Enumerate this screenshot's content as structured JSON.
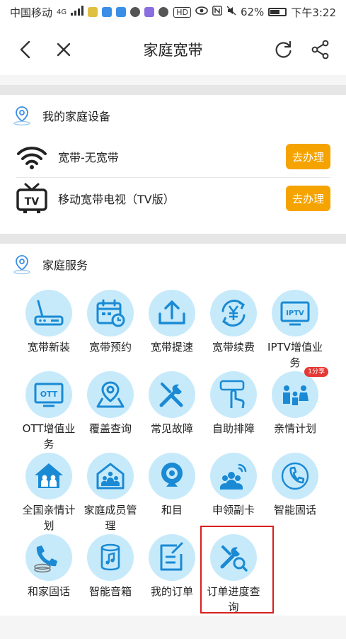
{
  "status_bar": {
    "carrier": "中国移动",
    "network": "4G",
    "battery_percent": "62%",
    "battery_level": 0.62,
    "time": "下午3:22",
    "hd": "HD"
  },
  "nav": {
    "title": "家庭宽带"
  },
  "devices": {
    "title": "我的家庭设备",
    "items": [
      {
        "name": "宽带-无宽带",
        "action": "去办理"
      },
      {
        "name": "移动宽带电视（TV版）",
        "action": "去办理",
        "tv_label": "TV"
      }
    ]
  },
  "services": {
    "title": "家庭服务",
    "items": [
      {
        "label": "宽带新装"
      },
      {
        "label": "宽带预约"
      },
      {
        "label": "宽带提速"
      },
      {
        "label": "宽带续费"
      },
      {
        "label": "IPTV增值业务",
        "icon_text": "IPTV"
      },
      {
        "label": "OTT增值业务",
        "icon_text": "OTT"
      },
      {
        "label": "覆盖查询"
      },
      {
        "label": "常见故障"
      },
      {
        "label": "自助排障"
      },
      {
        "label": "亲情计划",
        "badge": "1分享"
      },
      {
        "label": "全国亲情计划"
      },
      {
        "label": "家庭成员管理"
      },
      {
        "label": "和目"
      },
      {
        "label": "申领副卡"
      },
      {
        "label": "智能固话"
      },
      {
        "label": "和家固话"
      },
      {
        "label": "智能音箱"
      },
      {
        "label": "我的订单"
      },
      {
        "label": "订单进度查询"
      }
    ]
  },
  "colors": {
    "accent": "#f5a300",
    "icon_blue": "#1a8ad4",
    "circle_bg": "#c7eafb",
    "highlight": "#d8201d"
  }
}
